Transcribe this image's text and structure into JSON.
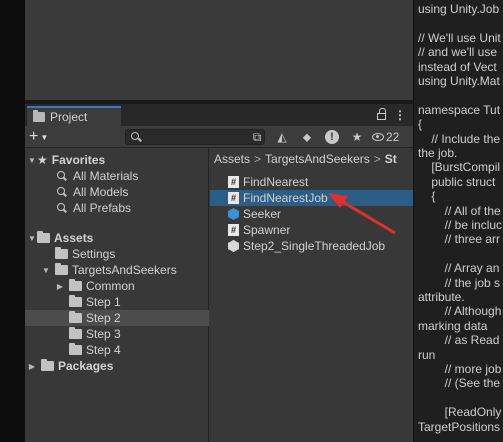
{
  "project_panel": {
    "tab_label": "Project",
    "hidden_count": "22",
    "add_symbol": "+",
    "menu_symbol": "⋮",
    "tree": [
      {
        "label": "Favorites",
        "kind": "favorites",
        "depth": 0,
        "expanded": true
      },
      {
        "label": "All Materials",
        "kind": "search",
        "depth": 1
      },
      {
        "label": "All Models",
        "kind": "search",
        "depth": 1
      },
      {
        "label": "All Prefabs",
        "kind": "search",
        "depth": 1
      },
      {
        "label": "Assets",
        "kind": "folder",
        "depth": 0,
        "expanded": true
      },
      {
        "label": "Settings",
        "kind": "folder",
        "depth": 1
      },
      {
        "label": "TargetsAndSeekers",
        "kind": "folder",
        "depth": 1,
        "expanded": true
      },
      {
        "label": "Common",
        "kind": "folder",
        "depth": 2,
        "collapsed": true
      },
      {
        "label": "Step 1",
        "kind": "folder",
        "depth": 2
      },
      {
        "label": "Step 2",
        "kind": "folder",
        "depth": 2,
        "selected": true
      },
      {
        "label": "Step 3",
        "kind": "folder",
        "depth": 2
      },
      {
        "label": "Step 4",
        "kind": "folder",
        "depth": 2
      },
      {
        "label": "Packages",
        "kind": "folder",
        "depth": 0,
        "collapsed": true
      }
    ],
    "breadcrumb": [
      "Assets",
      "TargetsAndSeekers",
      "St"
    ],
    "files": [
      {
        "name": "FindNearest",
        "icon": "csharp-script-icon"
      },
      {
        "name": "FindNearestJob",
        "icon": "csharp-script-icon",
        "selected": true
      },
      {
        "name": "Seeker",
        "icon": "prefab-icon"
      },
      {
        "name": "Spawner",
        "icon": "csharp-script-icon"
      },
      {
        "name": "Step2_SingleThreadedJob",
        "icon": "scene-icon"
      }
    ]
  },
  "code_lines": [
    "using Unity.Job",
    "",
    "// We'll use Unit",
    "// and we'll use",
    "instead of Vect",
    "using Unity.Mat",
    "",
    "namespace Tut",
    "{",
    "    // Include the",
    "the job.",
    "    [BurstCompil",
    "    public struct",
    "    {",
    "        // All of the",
    "        // be incluc",
    "        // three arr",
    "",
    "        // Array an",
    "        // the job s",
    "attribute.",
    "        // Although",
    "marking data",
    "        // as Read",
    "run",
    "        // more job",
    "        // (See the",
    "",
    "        [ReadOnly",
    "TargetPositions"
  ],
  "colors": {
    "selection_blue": "#2c5d87",
    "annotation_red": "#e0302a",
    "tab_accent": "#3a79bb"
  }
}
